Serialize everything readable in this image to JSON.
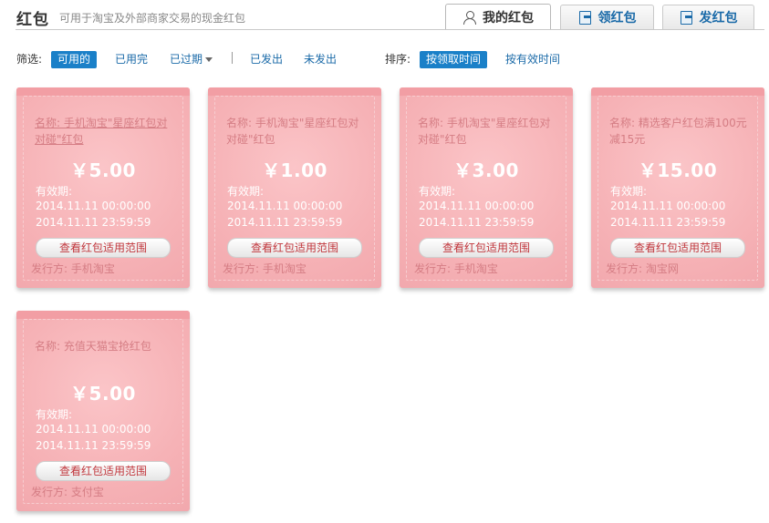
{
  "header": {
    "title": "红包",
    "subtitle": "可用于淘宝及外部商家交易的现金红包",
    "tabs": [
      {
        "label": "我的红包",
        "icon": "user-icon",
        "active": true
      },
      {
        "label": "领红包",
        "icon": "envelope-in-icon",
        "active": false
      },
      {
        "label": "发红包",
        "icon": "envelope-out-icon",
        "active": false
      }
    ]
  },
  "filter": {
    "label": "筛选:",
    "options": [
      "可用的",
      "已用完",
      "已过期",
      "已发出",
      "未发出"
    ],
    "selected": "可用的"
  },
  "sort": {
    "label": "排序:",
    "options": [
      "按领取时间",
      "按有效时间"
    ],
    "selected": "按领取时间"
  },
  "cards": [
    {
      "name": "名称: 手机淘宝\"星座红包对对碰\"红包",
      "amount": "￥5.00",
      "validity_label": "有效期:",
      "start": "2014.11.11 00:00:00",
      "end": "2014.11.11 23:59:59",
      "button": "查看红包适用范围",
      "issuer": "发行方: 手机淘宝"
    },
    {
      "name": "名称: 手机淘宝\"星座红包对对碰\"红包",
      "amount": "￥1.00",
      "validity_label": "有效期:",
      "start": "2014.11.11 00:00:00",
      "end": "2014.11.11 23:59:59",
      "button": "查看红包适用范围",
      "issuer": "发行方: 手机淘宝"
    },
    {
      "name": "名称: 手机淘宝\"星座红包对对碰\"红包",
      "amount": "￥3.00",
      "validity_label": "有效期:",
      "start": "2014.11.11 00:00:00",
      "end": "2014.11.11 23:59:59",
      "button": "查看红包适用范围",
      "issuer": "发行方: 手机淘宝"
    },
    {
      "name": "名称: 精选客户红包满100元减15元",
      "amount": "￥15.00",
      "validity_label": "有效期:",
      "start": "2014.11.11 00:00:00",
      "end": "2014.11.11 23:59:59",
      "button": "查看红包适用范围",
      "issuer": "发行方: 淘宝网"
    },
    {
      "name": "名称: 充值天猫宝抢红包",
      "amount": "￥5.00",
      "validity_label": "有效期:",
      "start": "2014.11.11 00:00:00",
      "end": "2014.11.11 23:59:59",
      "button": "查看红包适用范围",
      "issuer": "发行方: 支付宝"
    }
  ],
  "colors": {
    "accent": "#1a80c8",
    "link": "#1a6aa8",
    "card": "#f6b2b6",
    "card_text": "#d57d84",
    "button_text": "#c1363c"
  }
}
